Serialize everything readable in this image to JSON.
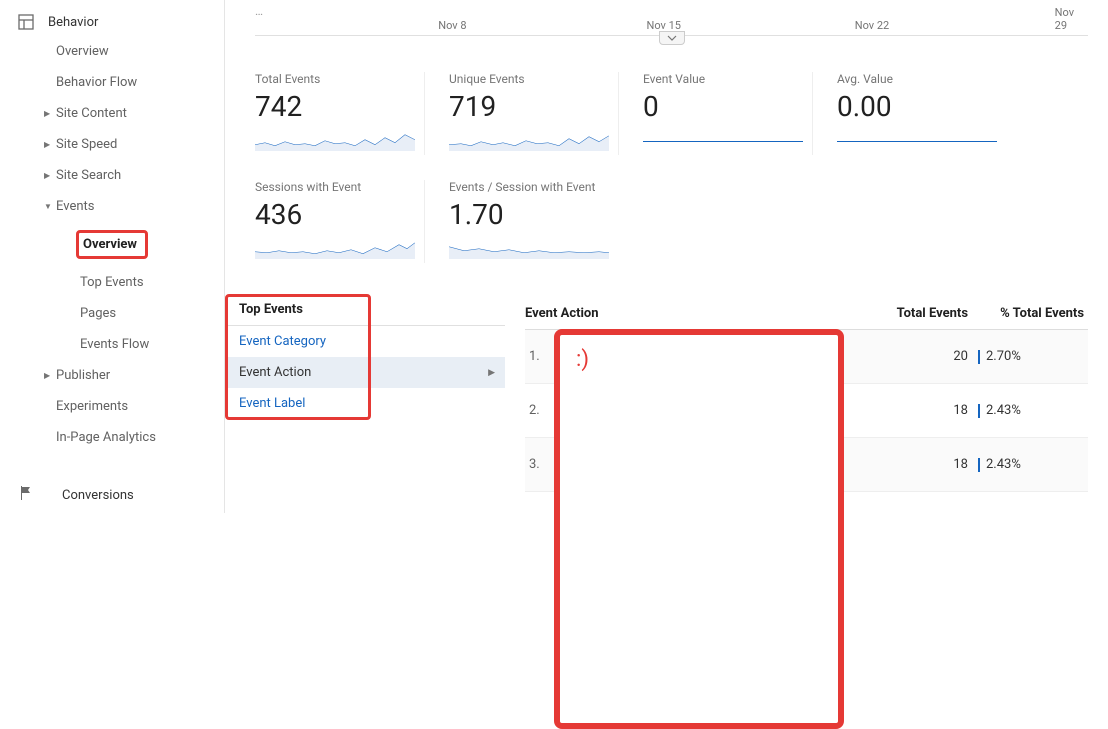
{
  "sidebar": {
    "behavior_label": "Behavior",
    "items": {
      "overview": "Overview",
      "behavior_flow": "Behavior Flow",
      "site_content": "Site Content",
      "site_speed": "Site Speed",
      "site_search": "Site Search",
      "events": "Events",
      "events_children": {
        "overview": "Overview",
        "top_events": "Top Events",
        "pages": "Pages",
        "events_flow": "Events Flow"
      },
      "publisher": "Publisher",
      "experiments": "Experiments",
      "in_page_analytics": "In-Page Analytics"
    },
    "conversions_label": "Conversions"
  },
  "timeline": {
    "ticks": [
      "Nov 8",
      "Nov 15",
      "Nov 22",
      "Nov 29"
    ]
  },
  "metrics": [
    {
      "title": "Total Events",
      "value": "742",
      "spark": true
    },
    {
      "title": "Unique Events",
      "value": "719",
      "spark": true
    },
    {
      "title": "Event Value",
      "value": "0",
      "spark": false
    },
    {
      "title": "Avg. Value",
      "value": "0.00",
      "spark": false
    }
  ],
  "metrics2": [
    {
      "title": "Sessions with Event",
      "value": "436",
      "spark": true
    },
    {
      "title": "Events / Session with Event",
      "value": "1.70",
      "spark": true
    }
  ],
  "dimension_selector": {
    "header": "Top Events",
    "items": [
      {
        "label": "Event Category",
        "selected": false
      },
      {
        "label": "Event Action",
        "selected": true
      },
      {
        "label": "Event Label",
        "selected": false
      }
    ]
  },
  "table": {
    "headers": {
      "action": "Event Action",
      "total": "Total Events",
      "pct": "% Total Events"
    },
    "rows": [
      {
        "n": "1.",
        "total": "20",
        "pct": "2.70%"
      },
      {
        "n": "2.",
        "total": "18",
        "pct": "2.43%"
      },
      {
        "n": "3.",
        "total": "18",
        "pct": "2.43%"
      }
    ]
  },
  "overlay_text": ":)"
}
